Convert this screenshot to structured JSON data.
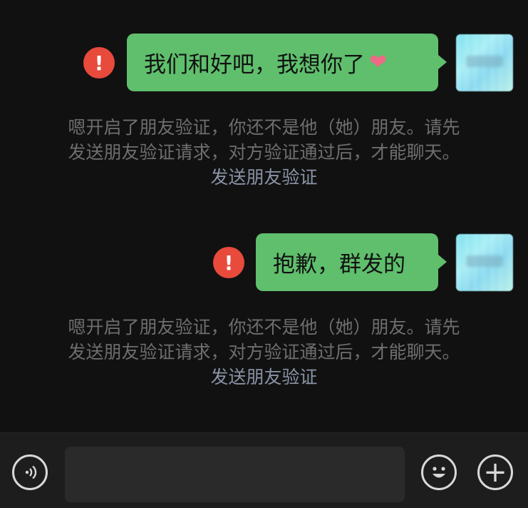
{
  "messages": [
    {
      "text": "我们和好吧，我想你了",
      "emoji": "❤",
      "error_glyph": "!",
      "notice": {
        "line1": "嗯开启了朋友验证，你还不是他（她）朋友。请先",
        "line2": "发送朋友验证请求，对方验证通过后，才能聊天。",
        "link": "发送朋友验证"
      }
    },
    {
      "text": "抱歉，群发的",
      "error_glyph": "!",
      "notice": {
        "line1": "嗯开启了朋友验证，你还不是他（她）朋友。请先",
        "line2": "发送朋友验证请求，对方验证通过后，才能聊天。",
        "link": "发送朋友验证"
      }
    }
  ],
  "input_bar": {
    "plus_glyph": "+",
    "icons": [
      "voice-icon",
      "emoji-icon",
      "plus-icon"
    ]
  },
  "colors": {
    "background": "#111111",
    "bubble": "#5fbf6c",
    "error": "#e84a3c",
    "notice_text": "#6e6e6e",
    "link_text": "#8a93a6"
  }
}
